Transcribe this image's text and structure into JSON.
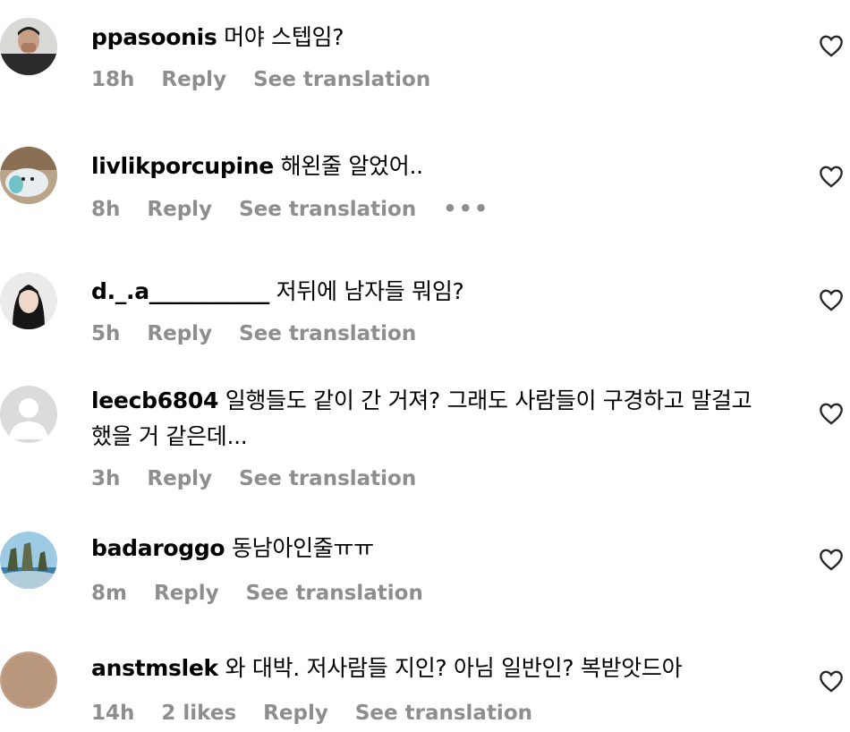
{
  "comments": [
    {
      "username": "ppasoonis",
      "text": "머야 스텝임?",
      "time": "18h",
      "reply": "Reply",
      "translate": "See translation",
      "likes": ""
    },
    {
      "username": "livlikporcupine",
      "text": "해왼줄 알었어..",
      "time": "8h",
      "reply": "Reply",
      "translate": "See translation",
      "more": "•••"
    },
    {
      "username": "d._.a___________",
      "text": "저뒤에 남자들 뭐임?",
      "time": "5h",
      "reply": "Reply",
      "translate": "See translation"
    },
    {
      "username": "leecb6804",
      "text": "일행들도 같이 간 거져? 그래도 사람들이 구경하고 말걸고",
      "text2": "했을 거 같은데...",
      "time": "3h",
      "reply": "Reply",
      "translate": "See translation"
    },
    {
      "username": "badaroggo",
      "text": "동남아인줄ㅠㅠ",
      "time": "8m",
      "reply": "Reply",
      "translate": "See translation"
    },
    {
      "username": "anstmslek",
      "text": "와 대박. 저사람들 지인? 아님 일반인? 복받앗드아",
      "time": "14h",
      "likes": "2 likes",
      "reply": "Reply",
      "translate": "See translation"
    }
  ]
}
